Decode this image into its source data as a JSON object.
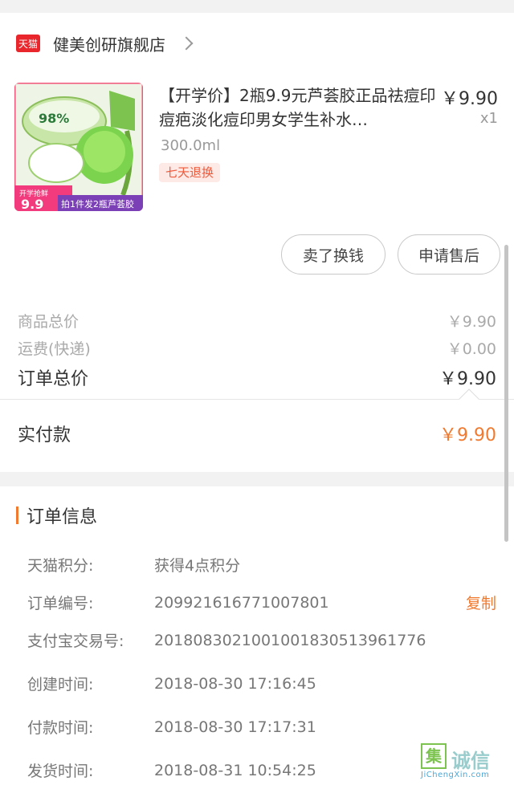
{
  "store": {
    "badge": "天猫",
    "name": "健美创研旗舰店"
  },
  "product": {
    "thumb_texts": [
      "98%",
      "开学抢鲜",
      "9.9",
      "拍1件发2瓶芦荟胶"
    ],
    "title": "【开学价】2瓶9.9元芦荟胶正品祛痘印痘疤淡化痘印男女学生补水…",
    "price": "￥9.90",
    "qty": "x1",
    "spec": "300.0ml",
    "tag": "七天退换"
  },
  "actions": {
    "sell": "卖了换钱",
    "aftersale": "申请售后"
  },
  "summary": {
    "goods_label": "商品总价",
    "goods_value": "￥9.90",
    "ship_label": "运费(快递)",
    "ship_value": "￥0.00",
    "total_label": "订单总价",
    "total_value": "￥9.90",
    "paid_label": "实付款",
    "paid_value": "￥9.90"
  },
  "order_info": {
    "title": "订单信息",
    "rows": [
      {
        "label": "天猫积分:",
        "value": "获得4点积分"
      },
      {
        "label": "订单编号:",
        "value": "209921616771007801",
        "action": "复制"
      },
      {
        "label": "支付宝交易号:",
        "value": "2018083021001001830513961776"
      },
      {
        "label": "创建时间:",
        "value": "2018-08-30  17:16:45"
      },
      {
        "label": "付款时间:",
        "value": "2018-08-30  17:17:31"
      },
      {
        "label": "发货时间:",
        "value": "2018-08-31  10:54:25"
      }
    ]
  },
  "watermark": {
    "box": "集",
    "text": "诚信",
    "url": "JiChengXin.com"
  },
  "colors": {
    "accent": "#f07a2f",
    "tmall_red": "#e8262c",
    "tag_bg": "#fde9e6"
  }
}
